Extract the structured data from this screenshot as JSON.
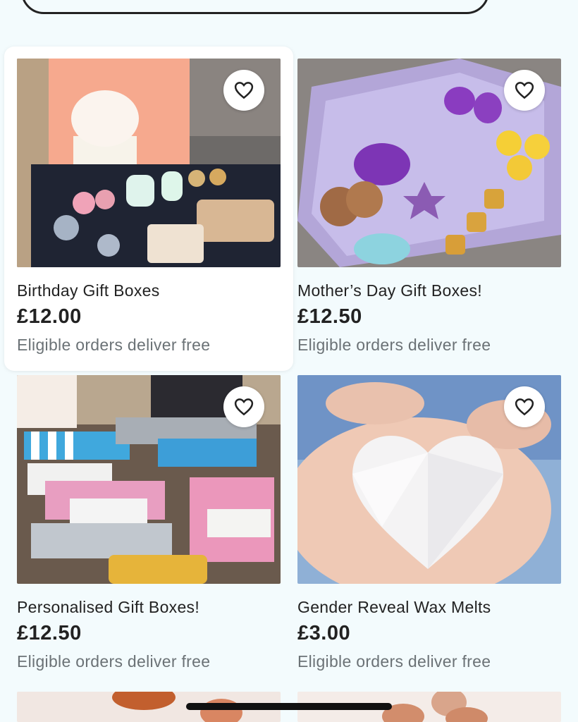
{
  "listings": [
    {
      "title": "Birthday Gift Boxes",
      "price": "£12.00",
      "shipping": "Eligible orders deliver free",
      "favorite_icon": "heart-outline-icon"
    },
    {
      "title": "Mother’s Day Gift Boxes!",
      "price": "£12.50",
      "shipping": "Eligible orders deliver free",
      "favorite_icon": "heart-outline-icon"
    },
    {
      "title": "Personalised Gift Boxes!",
      "price": "£12.50",
      "shipping": "Eligible orders deliver free",
      "favorite_icon": "heart-outline-icon"
    },
    {
      "title": "Gender Reveal Wax Melts",
      "price": "£3.00",
      "shipping": "Eligible orders deliver free",
      "favorite_icon": "heart-outline-icon"
    }
  ],
  "colors": {
    "background": "#f3fbfd",
    "text": "#222222",
    "muted_text": "#6b7276",
    "card_highlight": "#ffffff"
  }
}
